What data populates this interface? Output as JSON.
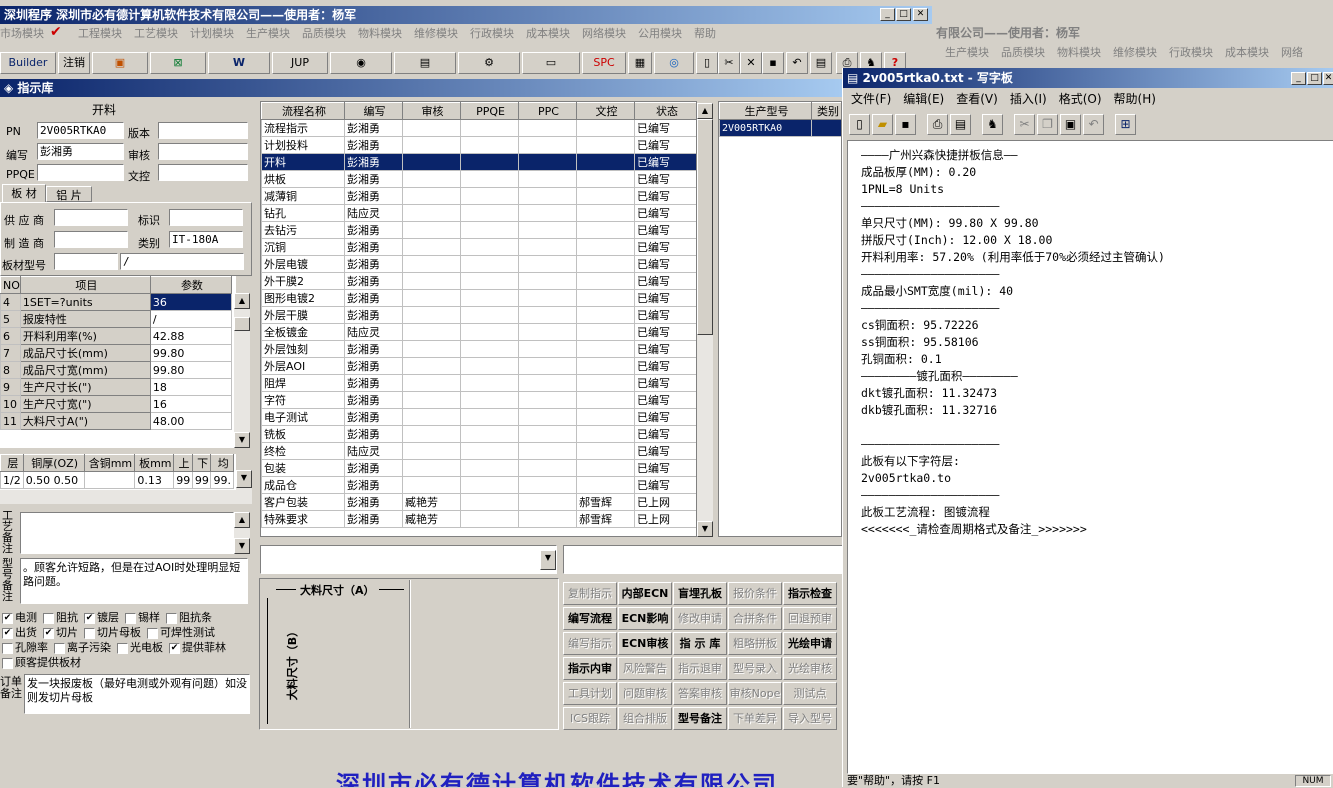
{
  "main": {
    "title": "深圳程序   深圳市必有德计算机软件技术有限公司——使用者：杨军",
    "menu": [
      "市场模块",
      "工程模块",
      "工艺模块",
      "计划模块",
      "生产模块",
      "品质模块",
      "物料模块",
      "维修模块",
      "行政模块",
      "成本模块",
      "网络模块",
      "公用模块",
      "帮助"
    ],
    "toolbar": [
      "Builder",
      "注销",
      "JUP",
      "SPC"
    ],
    "bg_window_title": "有限公司——使用者：杨军",
    "bg_menu": [
      "生产模块",
      "品质模块",
      "物料模块",
      "维修模块",
      "行政模块",
      "成本模块",
      "网络"
    ]
  },
  "child": {
    "title": "指示库"
  },
  "left": {
    "section_title": "开料",
    "pn_label": "PN",
    "pn_value": "2V005RTKA0",
    "version_label": "版本",
    "version_value": "",
    "author_label": "编写",
    "author_value": "彭湘勇",
    "review_label": "审核",
    "review_value": "",
    "ppqe_label": "PPQE",
    "ppqe_value": "",
    "doc_label": "文控",
    "doc_value": "",
    "tabs": [
      "板 材",
      "铝 片"
    ],
    "supplier_label": "供 应 商",
    "supplier_value": "",
    "mark_label": "标识",
    "mark_value": "",
    "maker_label": "制 造 商",
    "maker_value": "",
    "type_label": "类别",
    "type_value": "IT-180A",
    "board_model_label": "板材型号",
    "board_model_value": "",
    "board_model_value2": "/",
    "param_headers": [
      "NO",
      "项目",
      "参数"
    ],
    "params": [
      {
        "no": "4",
        "item": "1SET=?units",
        "val": "36"
      },
      {
        "no": "5",
        "item": "报废特性",
        "val": "/"
      },
      {
        "no": "6",
        "item": "开料利用率(%)",
        "val": "42.88"
      },
      {
        "no": "7",
        "item": "成品尺寸长(mm)",
        "val": "99.80"
      },
      {
        "no": "8",
        "item": "成品尺寸宽(mm)",
        "val": "99.80"
      },
      {
        "no": "9",
        "item": "生产尺寸长(\")",
        "val": "18"
      },
      {
        "no": "10",
        "item": "生产尺寸宽(\")",
        "val": "16"
      },
      {
        "no": "11",
        "item": "大料尺寸A(\")",
        "val": "48.00"
      }
    ],
    "layer_headers": [
      "层",
      "铜厚(OZ)",
      "含铜mm",
      "板mm",
      "上",
      "下",
      "均"
    ],
    "layer_row": [
      "1/2",
      "0.50 0.50",
      "",
      "0.13",
      "99",
      "99",
      "99."
    ],
    "process_note_label": "工艺备注",
    "model_note_label": "型号备注",
    "model_note_text": "。顾客允许短路，但是在过AOI时处理明显短路问题。",
    "checks": [
      [
        {
          "t": "电测",
          "c": true
        },
        {
          "t": "阻抗",
          "c": false
        },
        {
          "t": "镀层",
          "c": true
        },
        {
          "t": "锡样",
          "c": false
        },
        {
          "t": "阻抗条",
          "c": false
        }
      ],
      [
        {
          "t": "出货",
          "c": true
        },
        {
          "t": "切片",
          "c": true
        },
        {
          "t": "切片母板",
          "c": false
        },
        {
          "t": "可焊性测试",
          "c": false
        }
      ],
      [
        {
          "t": "孔隙率",
          "c": false
        },
        {
          "t": "离子污染",
          "c": false
        },
        {
          "t": "光电板",
          "c": false
        },
        {
          "t": "提供菲林",
          "c": true
        }
      ],
      [
        {
          "t": "顾客提供板材",
          "c": false
        }
      ]
    ],
    "order_note_label": "订单备注",
    "order_note_text": "发一块报废板（最好电测或外观有问题）如没则发切片母板"
  },
  "flow": {
    "headers": [
      "流程名称",
      "编写",
      "审核",
      "PPQE",
      "PPC",
      "文控",
      "状态"
    ],
    "rows": [
      [
        "流程指示",
        "彭湘勇",
        "",
        "",
        "",
        "",
        "已编写"
      ],
      [
        "计划投料",
        "彭湘勇",
        "",
        "",
        "",
        "",
        "已编写"
      ],
      [
        "开料",
        "彭湘勇",
        "",
        "",
        "",
        "",
        "已编写"
      ],
      [
        "烘板",
        "彭湘勇",
        "",
        "",
        "",
        "",
        "已编写"
      ],
      [
        "减薄铜",
        "彭湘勇",
        "",
        "",
        "",
        "",
        "已编写"
      ],
      [
        "钻孔",
        "陆应灵",
        "",
        "",
        "",
        "",
        "已编写"
      ],
      [
        "去钻污",
        "彭湘勇",
        "",
        "",
        "",
        "",
        "已编写"
      ],
      [
        "沉铜",
        "彭湘勇",
        "",
        "",
        "",
        "",
        "已编写"
      ],
      [
        "外层电镀",
        "彭湘勇",
        "",
        "",
        "",
        "",
        "已编写"
      ],
      [
        "外干膜2",
        "彭湘勇",
        "",
        "",
        "",
        "",
        "已编写"
      ],
      [
        "图形电镀2",
        "彭湘勇",
        "",
        "",
        "",
        "",
        "已编写"
      ],
      [
        "外层干膜",
        "彭湘勇",
        "",
        "",
        "",
        "",
        "已编写"
      ],
      [
        "全板镀金",
        "陆应灵",
        "",
        "",
        "",
        "",
        "已编写"
      ],
      [
        "外层蚀刻",
        "彭湘勇",
        "",
        "",
        "",
        "",
        "已编写"
      ],
      [
        "外层AOI",
        "彭湘勇",
        "",
        "",
        "",
        "",
        "已编写"
      ],
      [
        "阻焊",
        "彭湘勇",
        "",
        "",
        "",
        "",
        "已编写"
      ],
      [
        "字符",
        "彭湘勇",
        "",
        "",
        "",
        "",
        "已编写"
      ],
      [
        "电子测试",
        "彭湘勇",
        "",
        "",
        "",
        "",
        "已编写"
      ],
      [
        "铣板",
        "彭湘勇",
        "",
        "",
        "",
        "",
        "已编写"
      ],
      [
        "终检",
        "陆应灵",
        "",
        "",
        "",
        "",
        "已编写"
      ],
      [
        "包装",
        "彭湘勇",
        "",
        "",
        "",
        "",
        "已编写"
      ],
      [
        "成品仓",
        "彭湘勇",
        "",
        "",
        "",
        "",
        "已编写"
      ],
      [
        "客户包装",
        "彭湘勇",
        "臧艳芳",
        "",
        "",
        "郝雪辉",
        "已上网"
      ],
      [
        "特殊要求",
        "彭湘勇",
        "臧艳芳",
        "",
        "",
        "郝雪辉",
        "已上网"
      ]
    ],
    "selected_row": 2
  },
  "model_list": {
    "headers": [
      "生产型号",
      "类别"
    ],
    "rows": [
      [
        "2V005RTKA0",
        ""
      ]
    ]
  },
  "diagram": {
    "a_label": "大料尺寸（A）",
    "b_label": "大料尺寸（B）"
  },
  "actions": [
    [
      {
        "t": "复制指示",
        "d": true
      },
      {
        "t": "内部ECN",
        "d": false
      },
      {
        "t": "盲埋孔板",
        "d": false
      },
      {
        "t": "报价条件",
        "d": true
      },
      {
        "t": "指示检查",
        "d": false
      }
    ],
    [
      {
        "t": "编写流程",
        "d": false
      },
      {
        "t": "ECN影响",
        "d": false
      },
      {
        "t": "修改申请",
        "d": true
      },
      {
        "t": "合拼条件",
        "d": true
      },
      {
        "t": "回退预审",
        "d": true
      }
    ],
    [
      {
        "t": "编写指示",
        "d": true
      },
      {
        "t": "ECN审核",
        "d": false
      },
      {
        "t": "指 示 库",
        "d": false
      },
      {
        "t": "粗略拼板",
        "d": true
      },
      {
        "t": "光绘申请",
        "d": false
      }
    ],
    [
      {
        "t": "指示内审",
        "d": false
      },
      {
        "t": "风险警告",
        "d": true
      },
      {
        "t": "指示退审",
        "d": true
      },
      {
        "t": "型号录入",
        "d": true
      },
      {
        "t": "光绘审核",
        "d": true
      }
    ],
    [
      {
        "t": "工具计划",
        "d": true
      },
      {
        "t": "问题审核",
        "d": true
      },
      {
        "t": "答案审核",
        "d": true
      },
      {
        "t": "审核Nope",
        "d": true
      },
      {
        "t": "测试点",
        "d": true
      }
    ],
    [
      {
        "t": "ICS跟踪",
        "d": true
      },
      {
        "t": "组合排版",
        "d": true
      },
      {
        "t": "型号备注",
        "d": false
      },
      {
        "t": "下单差异",
        "d": true
      },
      {
        "t": "导入型号",
        "d": true
      }
    ]
  ],
  "footer_banner": "深圳市必有德计算机软件技术有限公司",
  "wordpad": {
    "title": "2v005rtka0.txt - 写字板",
    "menu": [
      "文件(F)",
      "编辑(E)",
      "查看(V)",
      "插入(I)",
      "格式(O)",
      "帮助(H)"
    ],
    "lines": [
      "————广州兴森快捷拼板信息——",
      "成品板厚(MM): 0.20",
      "1PNL=8 Units",
      "————————————————————",
      "单只尺寸(MM): 99.80 X 99.80",
      "拼版尺寸(Inch): 12.00 X 18.00",
      "开料利用率: 57.20% (利用率低于70%必须经过主管确认)",
      "————————————————————",
      "成品最小SMT宽度(mil): 40",
      "————————————————————",
      "cs铜面积: 95.72226",
      "ss铜面积: 95.58106",
      "孔铜面积: 0.1",
      "————————镀孔面积————————",
      "dkt镀孔面积: 11.32473",
      "dkb镀孔面积: 11.32716",
      "",
      "————————————————————",
      "此板有以下字符层:",
      "2v005rtka0.to",
      "————————————————————",
      "此板工艺流程: 图镀流程",
      "<<<<<<<_请检查周期格式及备注_>>>>>>>"
    ],
    "status": "要\"帮助\"，请按 F1",
    "status_num": "NUM"
  }
}
